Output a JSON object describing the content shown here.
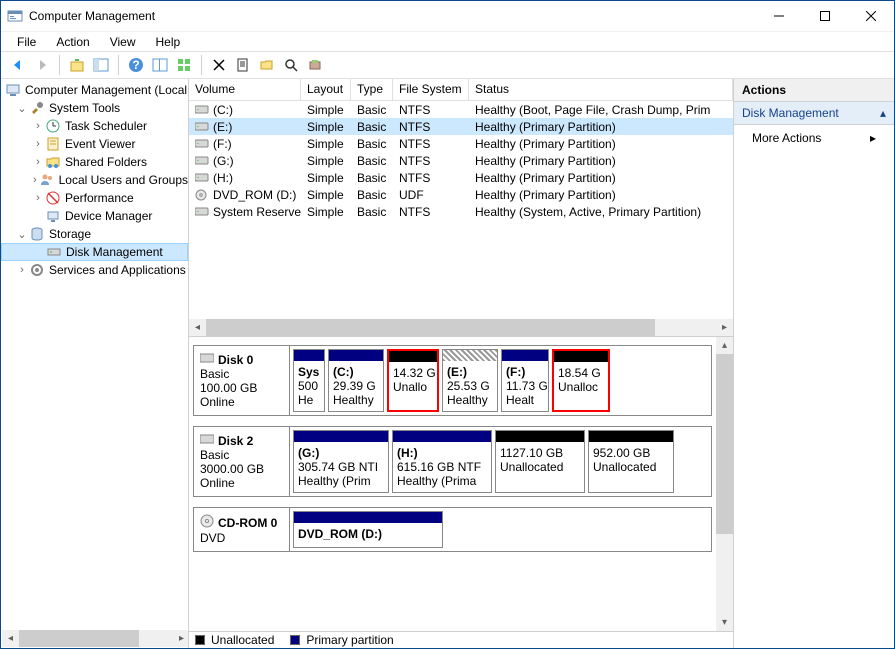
{
  "window": {
    "title": "Computer Management"
  },
  "menu": {
    "file": "File",
    "action": "Action",
    "view": "View",
    "help": "Help"
  },
  "tree": {
    "root": "Computer Management (Local",
    "system_tools": "System Tools",
    "task_scheduler": "Task Scheduler",
    "event_viewer": "Event Viewer",
    "shared_folders": "Shared Folders",
    "local_users": "Local Users and Groups",
    "performance": "Performance",
    "device_manager": "Device Manager",
    "storage": "Storage",
    "disk_management": "Disk Management",
    "services": "Services and Applications"
  },
  "vol_headers": {
    "volume": "Volume",
    "layout": "Layout",
    "type": "Type",
    "fs": "File System",
    "status": "Status"
  },
  "volumes": [
    {
      "name": "(C:)",
      "layout": "Simple",
      "type": "Basic",
      "fs": "NTFS",
      "status": "Healthy (Boot, Page File, Crash Dump, Prim"
    },
    {
      "name": "(E:)",
      "layout": "Simple",
      "type": "Basic",
      "fs": "NTFS",
      "status": "Healthy (Primary Partition)"
    },
    {
      "name": "(F:)",
      "layout": "Simple",
      "type": "Basic",
      "fs": "NTFS",
      "status": "Healthy (Primary Partition)"
    },
    {
      "name": "(G:)",
      "layout": "Simple",
      "type": "Basic",
      "fs": "NTFS",
      "status": "Healthy (Primary Partition)"
    },
    {
      "name": "(H:)",
      "layout": "Simple",
      "type": "Basic",
      "fs": "NTFS",
      "status": "Healthy (Primary Partition)"
    },
    {
      "name": "DVD_ROM (D:)",
      "layout": "Simple",
      "type": "Basic",
      "fs": "UDF",
      "status": "Healthy (Primary Partition)"
    },
    {
      "name": "System Reserved",
      "layout": "Simple",
      "type": "Basic",
      "fs": "NTFS",
      "status": "Healthy (System, Active, Primary Partition)"
    }
  ],
  "disks": {
    "d0": {
      "name": "Disk 0",
      "type": "Basic",
      "size": "100.00 GB",
      "status": "Online"
    },
    "d0p": [
      {
        "name": "Sys",
        "size": "500",
        "stat": "He"
      },
      {
        "name": "(C:)",
        "size": "29.39 G",
        "stat": "Healthy"
      },
      {
        "name": "",
        "size": "14.32 G",
        "stat": "Unallo"
      },
      {
        "name": "(E:)",
        "size": "25.53 G",
        "stat": "Healthy"
      },
      {
        "name": "(F:)",
        "size": "11.73 G",
        "stat": "Healt"
      },
      {
        "name": "",
        "size": "18.54 G",
        "stat": "Unalloc"
      }
    ],
    "d2": {
      "name": "Disk 2",
      "type": "Basic",
      "size": "3000.00 GB",
      "status": "Online"
    },
    "d2p": [
      {
        "name": "(G:)",
        "size": "305.74 GB NTI",
        "stat": "Healthy (Prim"
      },
      {
        "name": "(H:)",
        "size": "615.16 GB NTF",
        "stat": "Healthy (Prima"
      },
      {
        "name": "",
        "size": "1127.10 GB",
        "stat": "Unallocated"
      },
      {
        "name": "",
        "size": "952.00 GB",
        "stat": "Unallocated"
      }
    ],
    "cd": {
      "name": "CD-ROM 0",
      "type": "DVD"
    },
    "cdp": {
      "name": "DVD_ROM  (D:)"
    }
  },
  "legend": {
    "unallocated": "Unallocated",
    "primary": "Primary partition"
  },
  "actions": {
    "head": "Actions",
    "sub": "Disk Management",
    "more": "More Actions"
  }
}
